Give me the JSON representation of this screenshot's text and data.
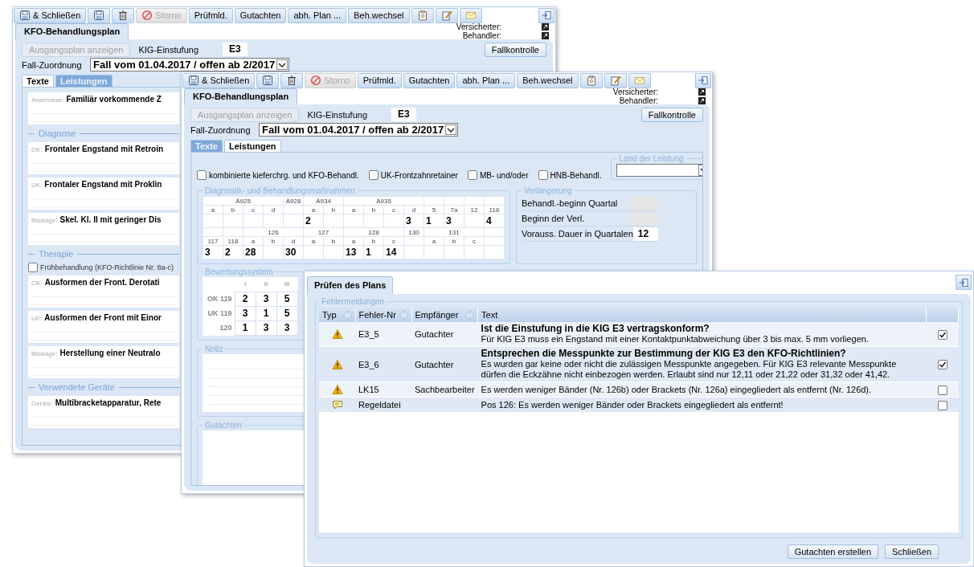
{
  "back_window": {
    "toolbar": [
      {
        "kind": "saveclose",
        "label": "& Schließen",
        "disabled": false
      },
      {
        "kind": "save",
        "disabled": false
      },
      {
        "kind": "delete",
        "disabled": false
      },
      {
        "kind": "cancel",
        "label": "Storno",
        "disabled": true
      },
      {
        "kind": "text",
        "label": "Prüfmld.",
        "disabled": false
      },
      {
        "kind": "text",
        "label": "Gutachten",
        "disabled": false
      },
      {
        "kind": "text",
        "label": "abh. Plan ...",
        "disabled": false
      },
      {
        "kind": "text",
        "label": "Beh.wechsel",
        "disabled": false
      },
      {
        "kind": "clipboard",
        "disabled": false
      },
      {
        "kind": "note",
        "disabled": false
      },
      {
        "kind": "mail",
        "disabled": false
      }
    ],
    "people": [
      "Versicherter:",
      "Behandler:"
    ],
    "plan_tab": "KFO-Behandlungsplan",
    "original_plan_button": {
      "label": "Ausgangsplan anzeigen",
      "disabled": true
    },
    "kig_label": "KIG-Einstufung",
    "kig_value": "E3",
    "check_button": "Fallkontrolle",
    "case_label": "Fall-Zuordnung",
    "case_value": "Fall vom 01.04.2017 / offen ab 2/2017",
    "tabs": [
      {
        "label": "Texte",
        "selected": true
      },
      {
        "label": "Leistungen",
        "selected": false
      }
    ],
    "texts": [
      {
        "kind": "field",
        "label": "Anamnese:",
        "value": "Familiär vorkommende Z"
      },
      {
        "kind": "heading",
        "label": "Diagnose"
      },
      {
        "kind": "field",
        "label": "OK:",
        "value": "Frontaler Engstand mit Retroin"
      },
      {
        "kind": "field",
        "label": "UK:",
        "value": "Frontaler Engstand mit Proklin"
      },
      {
        "kind": "field",
        "label": "Bisslage:",
        "value": "Skel. Kl. II mit geringer Dis"
      },
      {
        "kind": "heading",
        "label": "Therapie"
      },
      {
        "kind": "checkbox",
        "label": "Frühbehandlung (KFO-Richtlinie Nr. 8a-c)",
        "checked": false
      },
      {
        "kind": "field",
        "label": "OK:",
        "value": "Ausformen der Front. Derotati"
      },
      {
        "kind": "field",
        "label": "UK:",
        "value": "Ausformen der Front mit Einor"
      },
      {
        "kind": "field",
        "label": "Bisslage:",
        "value": "Herstellung einer Neutralo"
      },
      {
        "kind": "heading",
        "label": "Verwendete Geräte"
      },
      {
        "kind": "field",
        "label": "Geräte:",
        "value": "Multibracketapparatur, Rete"
      }
    ]
  },
  "front_window": {
    "toolbar": [
      {
        "kind": "saveclose",
        "label": "& Schließen",
        "disabled": false
      },
      {
        "kind": "save",
        "disabled": false
      },
      {
        "kind": "delete",
        "disabled": false
      },
      {
        "kind": "cancel",
        "label": "Storno",
        "disabled": true
      },
      {
        "kind": "text",
        "label": "Prüfmld.",
        "disabled": false
      },
      {
        "kind": "text",
        "label": "Gutachten",
        "disabled": false
      },
      {
        "kind": "text",
        "label": "abh. Plan ...",
        "disabled": false
      },
      {
        "kind": "text",
        "label": "Beh.wechsel",
        "disabled": false
      },
      {
        "kind": "clipboard",
        "disabled": false
      },
      {
        "kind": "note",
        "disabled": false
      },
      {
        "kind": "mail",
        "disabled": false
      }
    ],
    "people": [
      "Versicherter:",
      "Behandler:"
    ],
    "plan_tab": "KFO-Behandlungsplan",
    "original_plan_button": {
      "label": "Ausgangsplan anzeigen",
      "disabled": true
    },
    "kig_label": "KIG-Einstufung",
    "kig_value": "E3",
    "check_button": "Fallkontrolle",
    "case_label": "Fall-Zuordnung",
    "case_value": "Fall vom 01.04.2017 / offen ab 2/2017",
    "tabs": [
      {
        "label": "Texte",
        "selected": false
      },
      {
        "label": "Leistungen",
        "selected": true
      }
    ],
    "services": {
      "options": [
        {
          "label": "kombinierte kieferchrg. und KFO-Behandl.",
          "checked": false
        },
        {
          "label": "UK-Frontzahnretainer",
          "checked": false
        },
        {
          "label": "MB- und/oder",
          "checked": false
        },
        {
          "label": "HNB-Behandl.",
          "checked": false
        }
      ],
      "country": {
        "title": "Land der Leistung"
      },
      "diagnostics": {
        "title": "Diagnostik- und Behandlungsmaßnahmen",
        "blocks": [
          [
            {
              "label": "Ä925",
              "columns": [
                {
                  "label": "a"
                },
                {
                  "label": "b"
                },
                {
                  "label": "c"
                },
                {
                  "label": "d"
                }
              ]
            },
            {
              "label": "Ä928",
              "columns": [
                {}
              ]
            },
            {
              "label": "Ä934",
              "columns": [
                {
                  "label": "a",
                  "value": "2"
                },
                {
                  "label": "b"
                }
              ]
            },
            {
              "label": "Ä935",
              "columns": [
                {
                  "label": "a"
                },
                {
                  "label": "b"
                },
                {
                  "label": "c"
                },
                {
                  "label": "d",
                  "value": "3"
                }
              ]
            },
            {
              "columns": [
                {
                  "label": "5",
                  "value": "1"
                }
              ]
            },
            {
              "columns": [
                {
                  "label": "7a",
                  "value": "3"
                }
              ]
            },
            {
              "columns": [
                {
                  "label": "12"
                }
              ]
            },
            {
              "columns": [
                {
                  "label": "116",
                  "value": "4"
                }
              ]
            }
          ],
          [
            {
              "columns": [
                {
                  "label": "117",
                  "value": "3"
                }
              ]
            },
            {
              "columns": [
                {
                  "label": "118",
                  "value": "2"
                }
              ]
            },
            {
              "label": "126",
              "columns": [
                {
                  "label": "a",
                  "value": "28"
                },
                {
                  "label": "b"
                },
                {
                  "label": "d",
                  "value": "30"
                }
              ]
            },
            {
              "label": "127",
              "columns": [
                {
                  "label": "a"
                },
                {
                  "label": "b"
                }
              ]
            },
            {
              "label": "128",
              "columns": [
                {
                  "label": "a",
                  "value": "13"
                },
                {
                  "label": "b",
                  "value": "1"
                },
                {
                  "label": "c",
                  "value": "14"
                }
              ]
            },
            {
              "label": "130",
              "columns": [
                {}
              ]
            },
            {
              "label": "131",
              "columns": [
                {
                  "label": "a"
                },
                {
                  "label": "b"
                },
                {
                  "label": "c"
                }
              ]
            },
            {
              "columns": [
                {}
              ]
            }
          ]
        ]
      },
      "extension": {
        "title": "Verlängerung",
        "rows": [
          {
            "label": "Behandl.-beginn Quartal",
            "disabled": true
          },
          {
            "label": "Beginn der Verl.",
            "disabled": true
          },
          {
            "label": "Vorauss. Dauer in Quartalen",
            "value": "12",
            "disabled": false
          }
        ]
      },
      "rating": {
        "title": "Bewertungssystem",
        "columns": [
          "I",
          "II",
          "III"
        ],
        "rows": [
          {
            "label": "OK 119",
            "values": [
              "2",
              "3",
              "5"
            ]
          },
          {
            "label": "UK 119",
            "values": [
              "3",
              "1",
              "5"
            ]
          },
          {
            "label": "120",
            "values": [
              "1",
              "3",
              "3"
            ]
          }
        ]
      },
      "notes": {
        "title": "Notiz"
      },
      "report": {
        "title": "Gutachten"
      }
    }
  },
  "check_dialog": {
    "tab": "Prüfen des Plans",
    "group": "Fehlermeldungen",
    "columns": [
      {
        "label": "Typ",
        "sortable": true
      },
      {
        "label": "Fehler-Nr",
        "sortable": true
      },
      {
        "label": "Empfänger",
        "sortable": true
      },
      {
        "label": "Text",
        "sortable": false
      }
    ],
    "errors": [
      {
        "kind": "warning",
        "code": "E3_5",
        "recipient": "Gutachter",
        "title": "Ist die Einstufung in die KIG E3 vertragskonform?",
        "text": "Für KIG E3 muss ein Engstand mit einer Kontaktpunktabweichung über 3 bis max. 5 mm vorliegen.",
        "checked": true
      },
      {
        "kind": "warning",
        "code": "E3_6",
        "recipient": "Gutachter",
        "title": "Entsprechen die Messpunkte zur Bestimmung der KIG E3 den KFO-Richtlinien?",
        "text": "Es wurden gar keine oder nicht die zulässigen Messpunkte angegeben. Für KIG E3 relevante Messpunkte dürfen die Eckzähne nicht einbezogen werden. Erlaubt sind nur 12,11 oder 21,22 oder 31,32 oder 41,42.",
        "checked": true
      },
      {
        "kind": "warning",
        "code": "LK15",
        "recipient": "Sachbearbeiter",
        "text": "Es werden weniger Bänder (Nr. 126b) oder Brackets (Nr. 126a) eingegliedert als entfernt (Nr. 126d).",
        "checked": false
      },
      {
        "kind": "rule",
        "code": "Regeldatei",
        "text": "Pos 126: Es werden weniger Bänder oder Brackets eingegliedert als entfernt!",
        "checked": false
      }
    ],
    "buttons": [
      "Gutachten erstellen",
      "Schließen"
    ]
  }
}
